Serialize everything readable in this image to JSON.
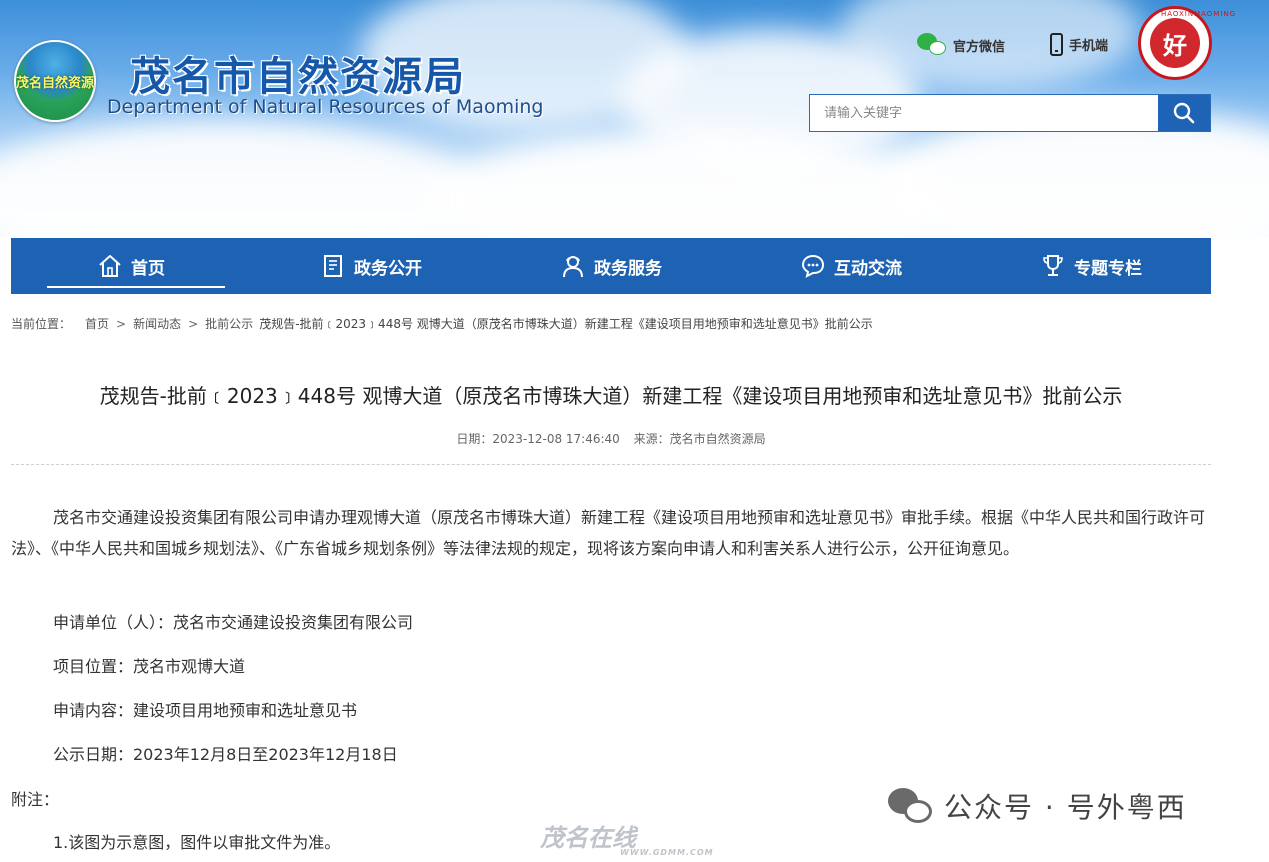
{
  "header": {
    "logo_text": "茂名自然资源",
    "title": "茂名市自然资源局",
    "subtitle": "Department of Natural Resources of Maoming",
    "links": [
      {
        "label": "官方微信",
        "icon": "wechat-icon"
      },
      {
        "label": "手机端",
        "icon": "mobile-phone-icon"
      }
    ],
    "emblem_ring": "HAOXINMAOMING",
    "emblem_glyph": "好",
    "search": {
      "placeholder": "请输入关键字",
      "button_icon": "magnifier-icon"
    }
  },
  "nav": {
    "items": [
      {
        "label": "首页",
        "icon": "home-icon",
        "active": true
      },
      {
        "label": "政务公开",
        "icon": "document-icon"
      },
      {
        "label": "政务服务",
        "icon": "service-person-icon"
      },
      {
        "label": "互动交流",
        "icon": "chat-bubble-icon"
      },
      {
        "label": "专题专栏",
        "icon": "trophy-icon"
      }
    ],
    "colors": {
      "bar": "#1e62b3",
      "text": "#ffffff"
    }
  },
  "breadcrumb": {
    "prefix": "当前位置：",
    "items": [
      "首页",
      "新闻动态",
      "批前公示"
    ],
    "current": "茂规告-批前﹝2023﹞448号 观博大道（原茂名市博珠大道）新建工程《建设项目用地预审和选址意见书》批前公示",
    "separator": ">"
  },
  "article": {
    "title": "茂规告-批前﹝2023﹞448号 观博大道（原茂名市博珠大道）新建工程《建设项目用地预审和选址意见书》批前公示",
    "meta": {
      "date": "日期：2023-12-08 17:46:40",
      "source": "来源：茂名市自然资源局"
    },
    "body": "茂名市交通建设投资集团有限公司申请办理观博大道（原茂名市博珠大道）新建工程《建设项目用地预审和选址意见书》审批手续。根据《中华人民共和国行政许可法》、《中华人民共和国城乡规划法》、《广东省城乡规划条例》等法律法规的规定，现将该方案向申请人和利害关系人进行公示，公开征询意见。",
    "applicant": "申请单位（人）：茂名市交通建设投资集团有限公司",
    "location": "项目位置：茂名市观博大道",
    "content": "申请内容：建设项目用地预审和选址意见书",
    "period": "公示日期：2023年12月8日至2023年12月18日",
    "note_label": "附注：",
    "note_1": "1.该图为示意图，图件以审批文件为准。"
  },
  "watermarks": {
    "wechat": "公众号 · 号外粤西",
    "site": "茂名在线",
    "site_url": "WWW.GDMM.COM"
  }
}
